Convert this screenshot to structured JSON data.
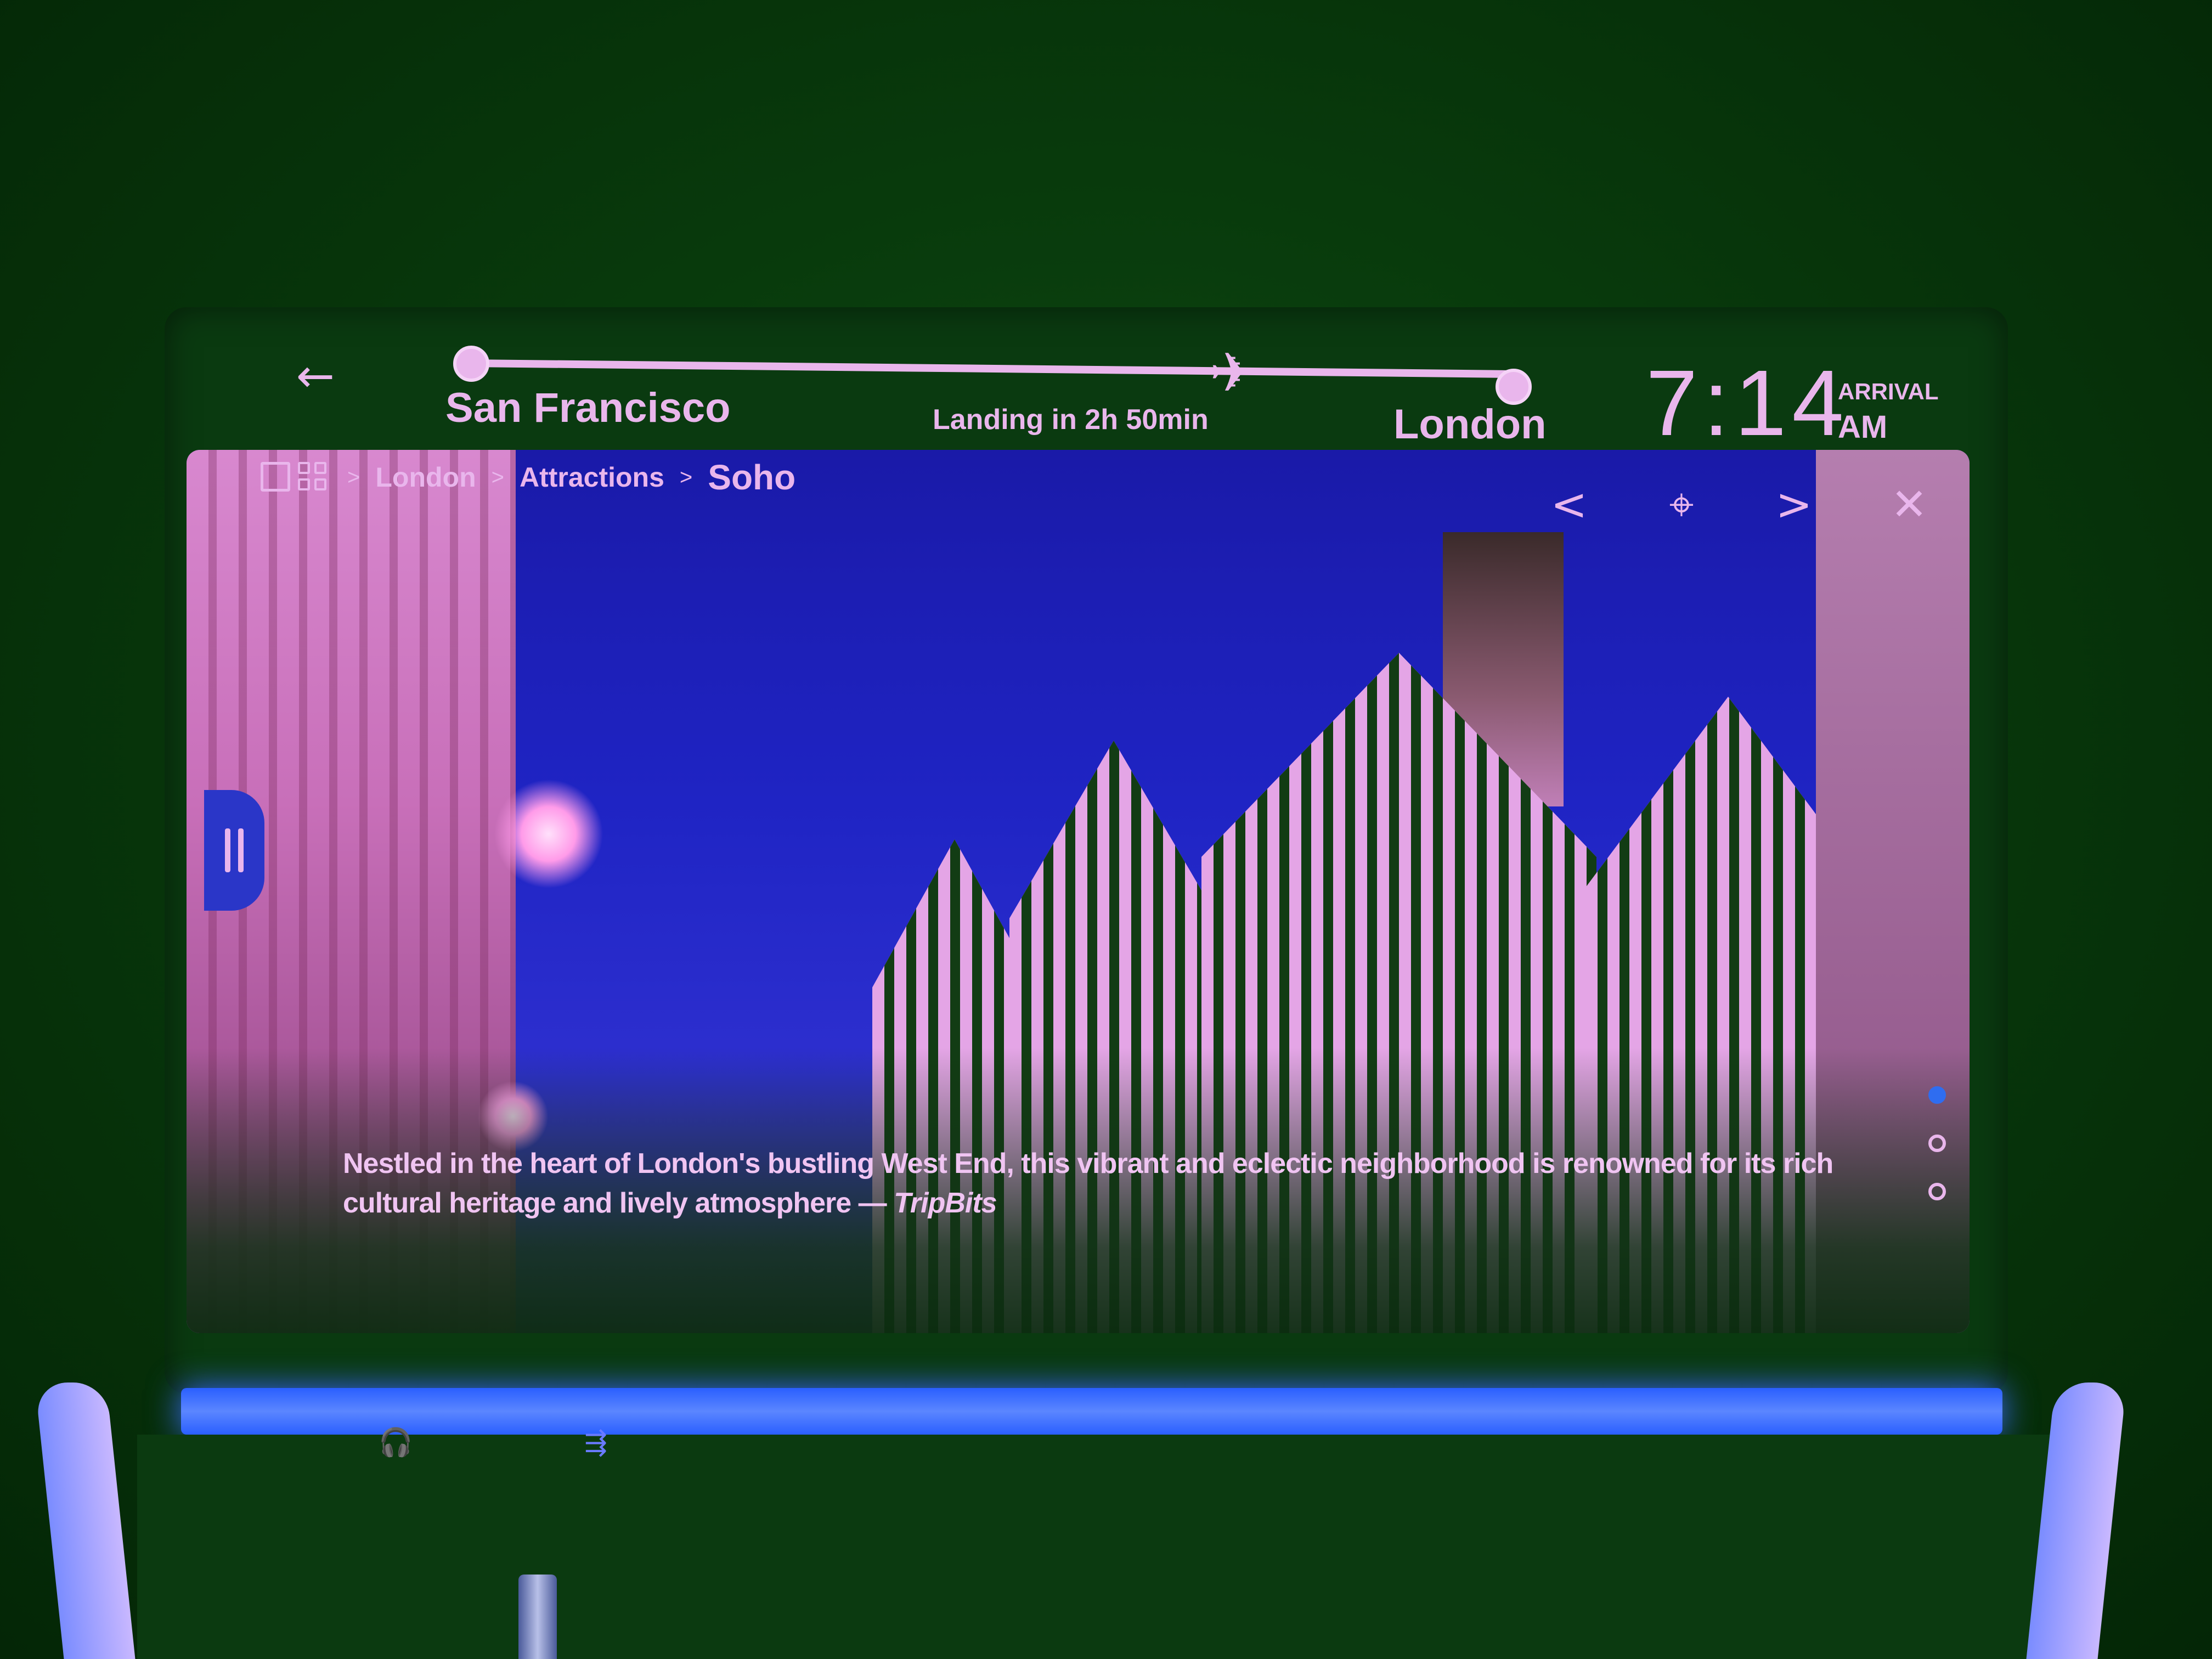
{
  "flight": {
    "origin": "San Francisco",
    "destination": "London",
    "status": "Landing in 2h 50min",
    "arrival_time": "7:14",
    "arrival_label": "ARRIVAL",
    "arrival_ampm": "AM",
    "progress": 0.73
  },
  "breadcrumb": {
    "items": [
      "London",
      "Attractions",
      "Soho"
    ],
    "separator": ">"
  },
  "controls": {
    "back": "←",
    "prev": "<",
    "pin": "⌖",
    "next": ">",
    "close": "✕"
  },
  "caption": {
    "text": "Nestled in the heart of London's bustling West End, this vibrant and eclectic neighborhood is renowned for its rich cultural heritage and lively atmosphere — ",
    "source": "TripBits"
  },
  "pager": {
    "count": 3,
    "active": 0
  },
  "colors": {
    "accent": "#e9b6ec",
    "pager_active": "#2f6df0",
    "console_light": "#3b6cff"
  },
  "icons": {
    "back": "left-arrow-icon",
    "plane": "airplane-icon",
    "gallery": "gallery-grid-icon",
    "pin": "map-pin-icon",
    "close": "close-icon",
    "pause": "pause-icon",
    "headphone": "headphone-jack-icon",
    "usb": "usb-port-icon"
  }
}
